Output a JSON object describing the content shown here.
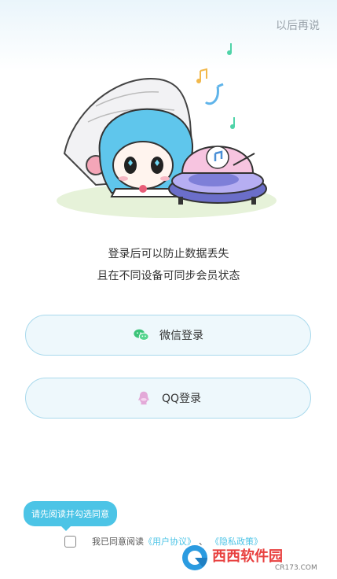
{
  "header": {
    "skip_label": "以后再说"
  },
  "description": {
    "line1": "登录后可以防止数据丢失",
    "line2": "且在不同设备可同步会员状态"
  },
  "buttons": {
    "wechat_label": "微信登录",
    "qq_label": "QQ登录"
  },
  "agreement": {
    "tooltip": "请先阅读并勾选同意",
    "prefix": "我已同意阅读",
    "user_agreement": "《用户协议》",
    "separator": "、",
    "privacy_policy": "《隐私政策》",
    "checked": false
  },
  "watermark": {
    "brand": "西西软件园",
    "url": "CR173.COM"
  },
  "colors": {
    "accent": "#4cc4e6",
    "button_border": "#a9d9ec",
    "button_bg": "#eef8fc",
    "wechat_green": "#3cc47a",
    "qq_pink": "#e3a9d8"
  },
  "icons": {
    "wechat": "wechat-icon",
    "qq": "qq-icon",
    "mascot": "mascot-illustration"
  }
}
